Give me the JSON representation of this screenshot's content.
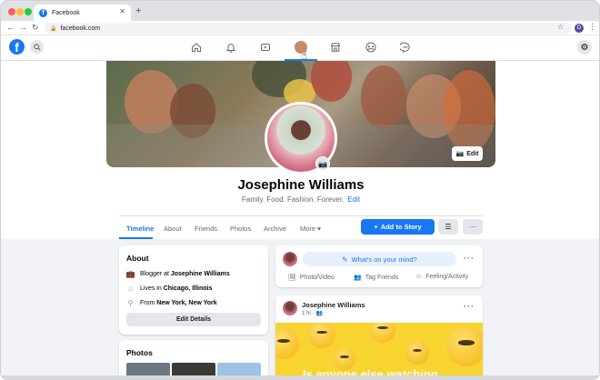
{
  "browser": {
    "tab_title": "Facebook",
    "tab_close": "✕",
    "new_tab": "+",
    "url": "facebook.com",
    "profile_initial": "D"
  },
  "header": {
    "logo_letter": "f",
    "active_nav": "profile"
  },
  "cover": {
    "edit_label": "Edit"
  },
  "profile": {
    "name": "Josephine Williams",
    "bio": "Family. Food. Fashion. Forever.",
    "bio_edit": "Edit"
  },
  "tabs": [
    {
      "label": "Timeline",
      "active": true
    },
    {
      "label": "About"
    },
    {
      "label": "Friends"
    },
    {
      "label": "Photos"
    },
    {
      "label": "Archive"
    },
    {
      "label": "More ▾"
    }
  ],
  "actions": {
    "add_story": "Add to Story",
    "list_icon": "list-icon",
    "more_icon": "ellipsis-icon"
  },
  "about": {
    "title": "About",
    "rows": [
      {
        "icon": "briefcase-icon",
        "prefix": "Blogger at ",
        "bold": "Josephine Williams"
      },
      {
        "icon": "home-icon",
        "prefix": "Lives in ",
        "bold": "Chicago, Illinois"
      },
      {
        "icon": "location-icon",
        "prefix": "From ",
        "bold": "New York, New York"
      }
    ],
    "edit_details": "Edit Details"
  },
  "photos": {
    "title": "Photos"
  },
  "composer": {
    "prompt": "What's on your mind?",
    "actions": [
      {
        "label": "Photo/Video",
        "icon": "photo-icon"
      },
      {
        "label": "Tag Friends",
        "icon": "tag-friends-icon"
      },
      {
        "label": "Feeling/Activity",
        "icon": "smiley-icon"
      }
    ]
  },
  "post": {
    "author": "Josephine Williams",
    "time": "1 hr · ",
    "image_text": "Is anyone else watching"
  },
  "colors": {
    "brand": "#1877f2",
    "page_bg": "#f0f2f5"
  }
}
